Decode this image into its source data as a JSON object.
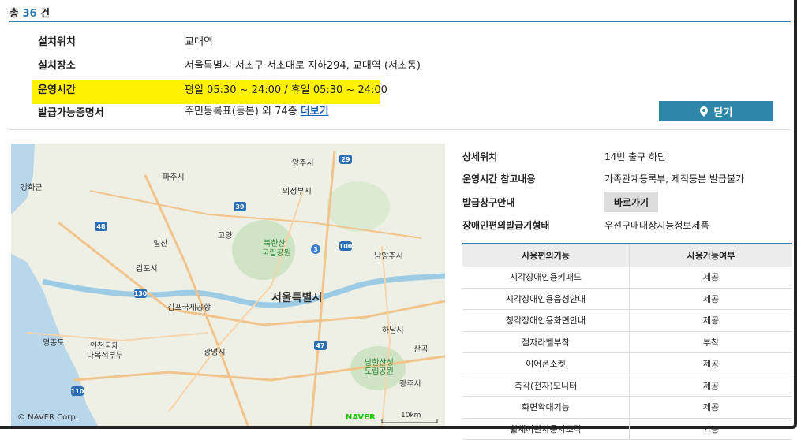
{
  "header": {
    "prefix": "총",
    "count": "36",
    "suffix": "건"
  },
  "info": {
    "location_label": "설치위치",
    "location_value": "교대역",
    "place_label": "설치장소",
    "place_value": "서울특별시 서초구 서초대로 지하294, 교대역 (서초동)",
    "hours_label": "운영시간",
    "hours_value": "평일 05:30 ~ 24:00 / 휴일 05:30 ~ 24:00",
    "certs_label": "발급가능증명서",
    "certs_value": "주민등록표(등본) 외 74종",
    "certs_more": "더보기"
  },
  "close_button": {
    "label": "닫기",
    "icon": "location-pin-icon"
  },
  "map": {
    "labels": {
      "yangju": "양주시",
      "paju": "파주시",
      "uijeongbu": "의정부시",
      "ganghwa": "강화군",
      "goyang": "고양",
      "bukhansan": "북한산",
      "bukhansan2": "국립공원",
      "namyangju": "남양주시",
      "gimpo": "김포시",
      "seoul": "서울특별시",
      "gimpo_airport": "김포국제공항",
      "gwangmyeong": "광명시",
      "incheon_airport": "인천국제",
      "incheon_airport2": "다목적부두",
      "yeongjong": "영종도",
      "namhansan": "남한산성",
      "namhansan2": "도립공원",
      "gwangju": "광주시",
      "hanam": "하남시",
      "ilsan": "일산",
      "sanguk": "산곡",
      "corp": "© NAVER Corp.",
      "naver": "NAVER",
      "scale": "10km"
    },
    "routes": {
      "r29": "29",
      "r39": "39",
      "r48": "48",
      "r130": "130",
      "r100": "100",
      "r47": "47",
      "r110": "110",
      "r3": "3"
    }
  },
  "details": {
    "detail_loc_label": "상세위치",
    "detail_loc_value": "14번 출구 하단",
    "hours_note_label": "운영시간 참고내용",
    "hours_note_value": "가족관계등록부, 제적등본 발급불가",
    "window_label": "발급창구안내",
    "window_button": "바로가기",
    "type_label": "장애인편의발급기형태",
    "type_value": "우선구매대상지능정보제품"
  },
  "facilities": {
    "headers": [
      "사용편의기능",
      "사용가능여부"
    ],
    "rows": [
      [
        "시각장애인용키패드",
        "제공"
      ],
      [
        "시각장애인용음성안내",
        "제공"
      ],
      [
        "청각장애인용화면안내",
        "제공"
      ],
      [
        "점자라벨부착",
        "부착"
      ],
      [
        "이어폰소켓",
        "제공"
      ],
      [
        "측각(전자)모니터",
        "제공"
      ],
      [
        "화면확대기능",
        "제공"
      ],
      [
        "휠체어탄사용자조작",
        "가능"
      ]
    ]
  },
  "colors": {
    "accent": "#2e87a8",
    "highlight": "#fff200"
  }
}
